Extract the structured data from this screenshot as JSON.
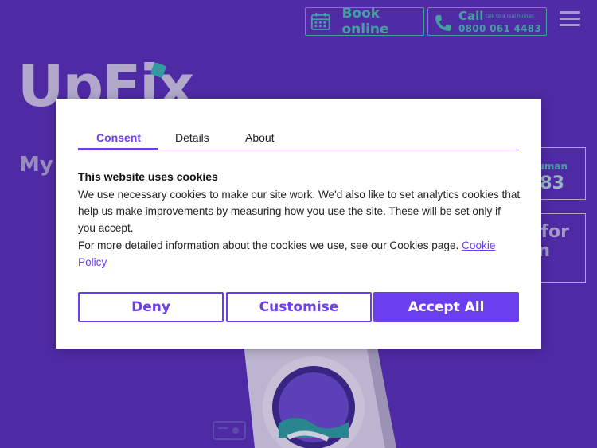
{
  "header": {
    "book_label": "Book online",
    "call_label": "Call",
    "call_tagline": "talk to a real human",
    "phone": "0800 061 4483"
  },
  "page": {
    "logo_text": "UpFix",
    "my_text": "My",
    "card_1_line_1": "uman",
    "card_1_line_2": "83",
    "card_2_line_1": "for",
    "card_2_line_2": "n"
  },
  "consent": {
    "tabs": [
      "Consent",
      "Details",
      "About"
    ],
    "title": "This website uses cookies",
    "paragraph_1": "We use necessary cookies to make our site work. We'd also like to set analytics cookies that help us make improvements by measuring how you use the site. These will be set only if you accept.",
    "paragraph_2": "For more detailed information about the cookies we use, see our Cookies page.",
    "link_text": "Cookie Policy",
    "deny_label": "Deny",
    "customise_label": "Customise",
    "accept_label": "Accept All"
  },
  "colors": {
    "background": "#5a33b8",
    "accent": "#6b3ef0",
    "teal": "#4cc9b0"
  }
}
